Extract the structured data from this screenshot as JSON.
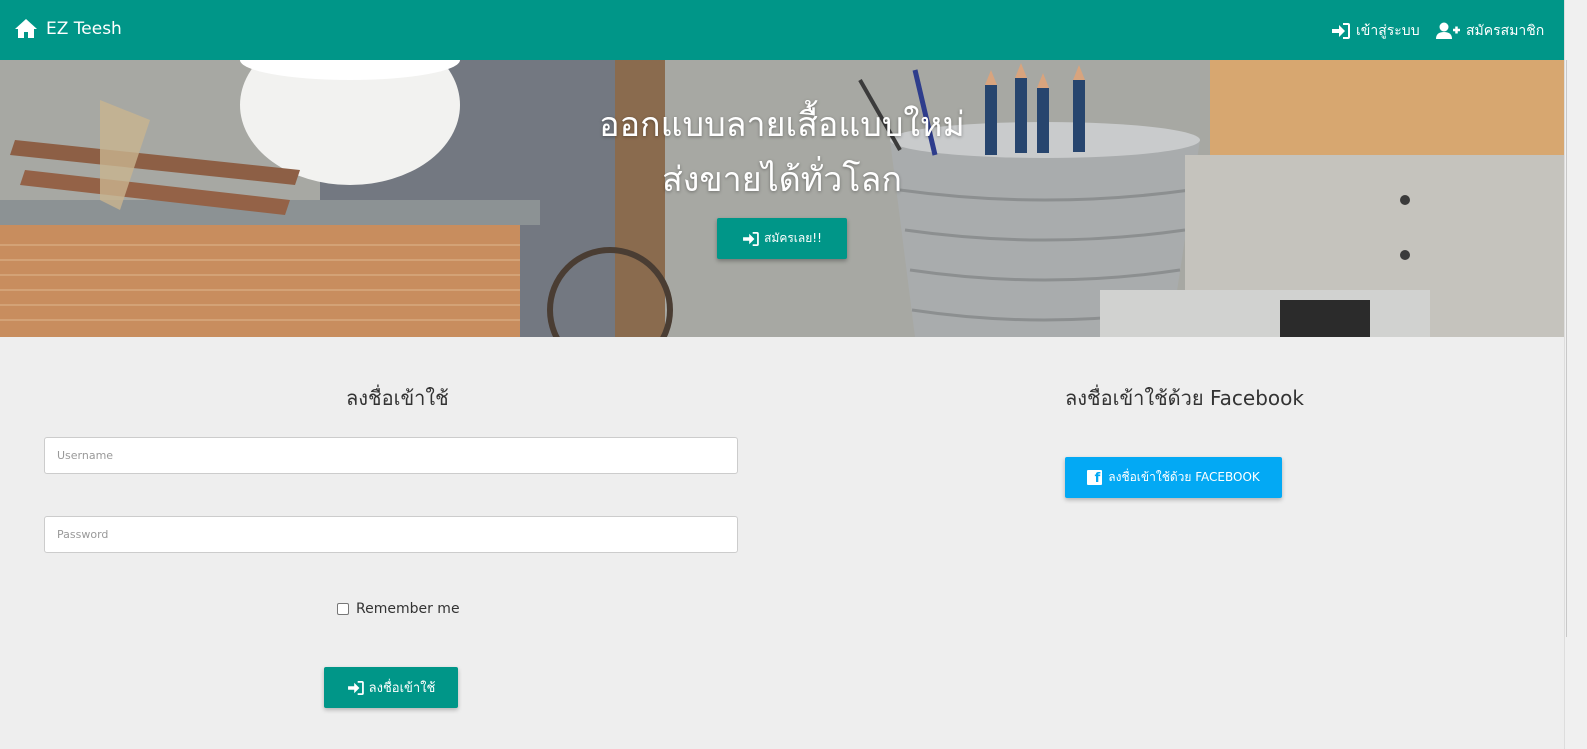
{
  "navbar": {
    "brand": "EZ Teesh",
    "login": "เข้าสู่ระบบ",
    "register": "สมัครสมาชิก",
    "color": "#009688"
  },
  "hero": {
    "line1": "ออกแบบลายเสื้อแบบใหม่",
    "line2": "ส่งขายได้ทั่วโลก",
    "cta": "สมัครเลย!!"
  },
  "login": {
    "title": "ลงชื่อเข้าใช้",
    "username_placeholder": "Username",
    "password_placeholder": "Password",
    "remember": "Remember me",
    "submit": "ลงชื่อเข้าใช้"
  },
  "facebook": {
    "title": "ลงชื่อเข้าใช้ด้วย Facebook",
    "button": "ลงชื่อเข้าใช้ด้วย FACEBOOK",
    "color": "#03a9f4"
  },
  "icons": {
    "home": "home-icon",
    "sign_in": "sign-in-icon",
    "user_plus": "user-plus-icon",
    "facebook": "facebook-icon"
  }
}
